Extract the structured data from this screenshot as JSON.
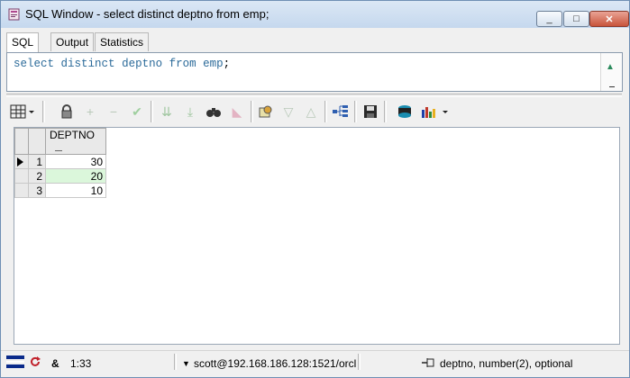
{
  "window": {
    "title": "SQL Window - select distinct deptno from emp;",
    "minimize_glyph": "_",
    "maximize_glyph": "□",
    "close_glyph": "✕"
  },
  "tabs": [
    {
      "label": "SQL",
      "active": true
    },
    {
      "label": "Output",
      "active": false
    },
    {
      "label": "Statistics",
      "active": false
    }
  ],
  "editor": {
    "tokens": [
      "select",
      " ",
      "distinct",
      " ",
      "deptno",
      " ",
      "from",
      " ",
      "emp",
      ";"
    ]
  },
  "grid": {
    "columns": [
      "DEPTNO"
    ],
    "rows": [
      {
        "row_number": "1",
        "deptno": "30",
        "current": true
      },
      {
        "row_number": "2",
        "deptno": "20",
        "current": false
      },
      {
        "row_number": "3",
        "deptno": "10",
        "current": false
      }
    ]
  },
  "status": {
    "cursor_position": "1:33",
    "connection": "scott@192.168.186.128:1521/orcl",
    "column_info": "deptno, number(2), optional",
    "ampersand": "&"
  },
  "colors": {
    "keyword": "#2c6b9a",
    "selected_cell": "#dbf7db",
    "accent": "#1a237e"
  }
}
